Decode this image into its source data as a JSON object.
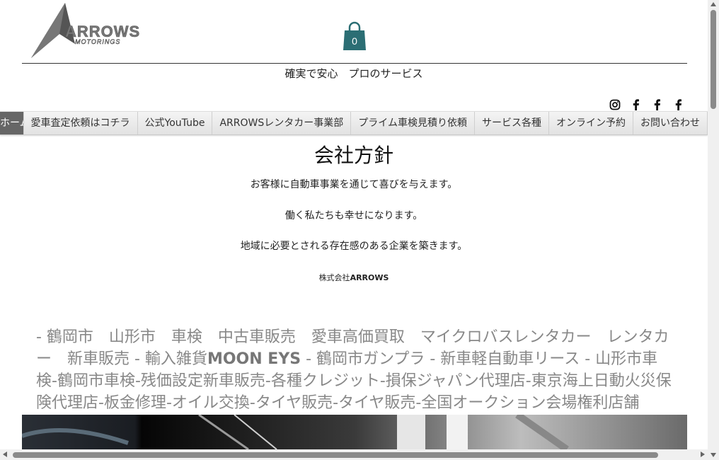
{
  "header": {
    "logo_text": "ARROWS",
    "logo_sub": "MOTORINGS",
    "cart_count": "0",
    "tagline": "確実で安心　プロのサービス"
  },
  "social": [
    "instagram-icon",
    "facebook-icon",
    "facebook-icon",
    "facebook-icon"
  ],
  "nav": {
    "items": [
      {
        "label": "ホーム"
      },
      {
        "label": "愛車査定依頼はコチラ"
      },
      {
        "label": "公式YouTube"
      },
      {
        "label": "ARROWSレンタカー事業部"
      },
      {
        "label": "プライム車検見積り依頼"
      },
      {
        "label": "サービス各種"
      },
      {
        "label": "オンライン予約"
      },
      {
        "label": "お問い合わせ"
      }
    ]
  },
  "main": {
    "title": "会社方針",
    "policies": [
      "お客様に自動車事業を通じて喜びを与えます。",
      "働く私たちも幸せになります。",
      "地域に必要とされる存在感のある企業を築きます。"
    ],
    "company_prefix": "株式会社",
    "company_name": "ARROWS",
    "keywords_a": "- 鶴岡市　山形市　車検　中古車販売　愛車高価買取　マイクロバスレンタカー　レンタカー　新車販売 - 輸入雑貨",
    "keywords_bold": "MOON EYS",
    "keywords_b": " - 鶴岡市ガンプラ - 新車軽自動車リース - 山形市車検-鶴岡市車検-残価設定新車販売-各種クレジット-損保ジャパン代理店-東京海上日動火災保険代理店-板金修理-オイル交換-タイヤ販売-タイヤ販売-全国オークション会場権利店舗"
  },
  "colors": {
    "cart": "#2b6e74",
    "nav_active": "#666666",
    "keyword_text": "#888888"
  }
}
